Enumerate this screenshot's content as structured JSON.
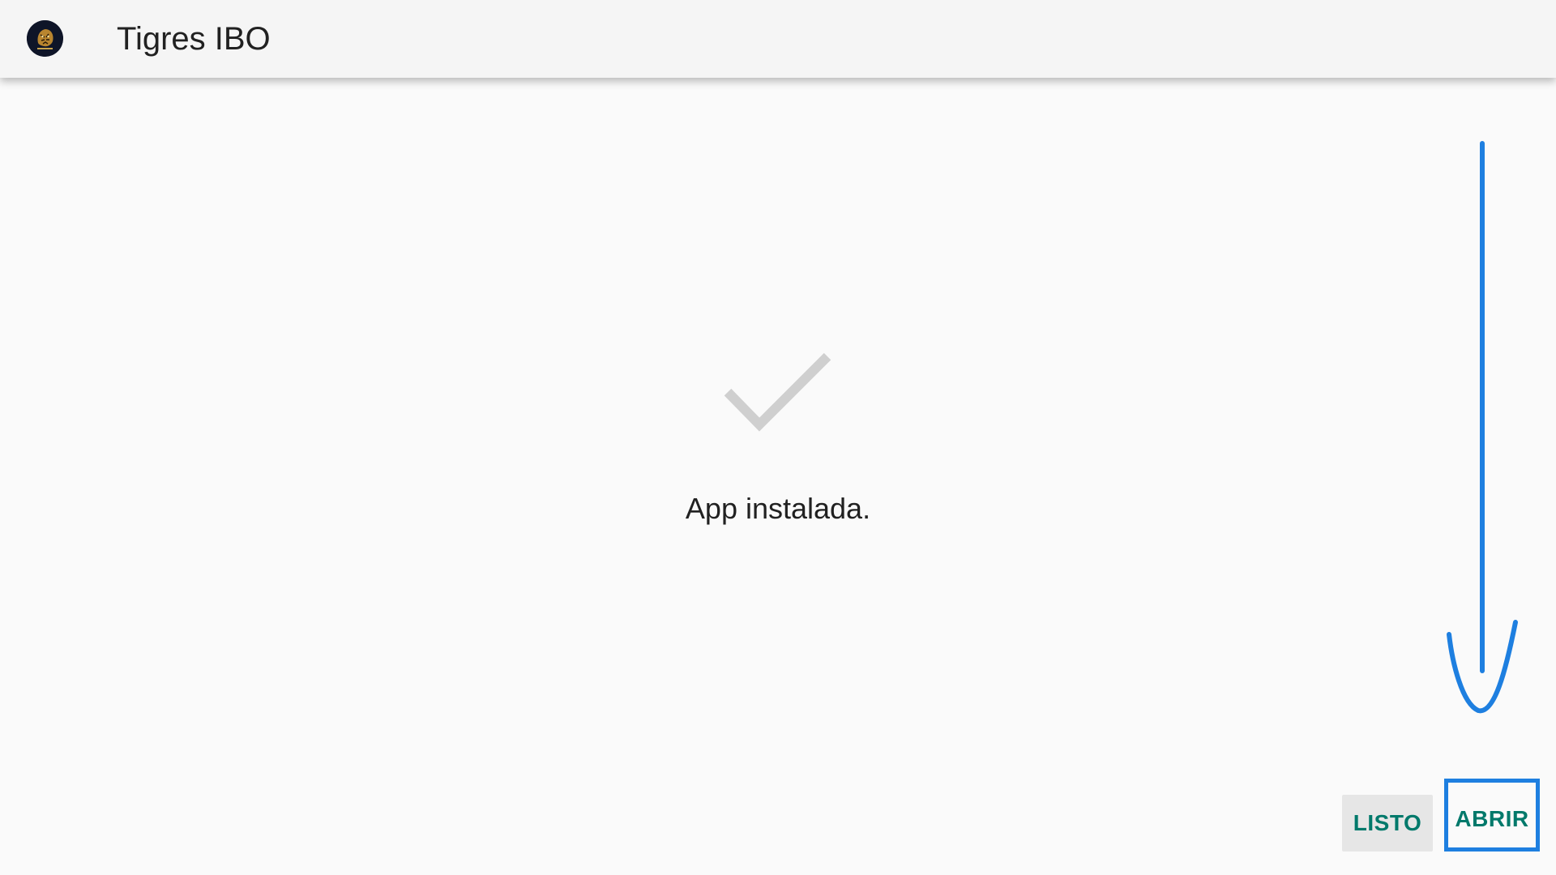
{
  "app_bar": {
    "title": "Tigres IBO",
    "icon": "tiger-logo-icon"
  },
  "main": {
    "status_icon": "checkmark-icon",
    "status_message": "App instalada."
  },
  "actions": {
    "done_label": "LISTO",
    "open_label": "ABRIR"
  },
  "annotation": {
    "arrow_icon": "arrow-down-icon",
    "highlight_color": "#1e7fe0"
  },
  "colors": {
    "accent": "#00796b",
    "background": "#fafafa",
    "app_bar": "#f5f5f5",
    "check": "#cfcfcf"
  }
}
